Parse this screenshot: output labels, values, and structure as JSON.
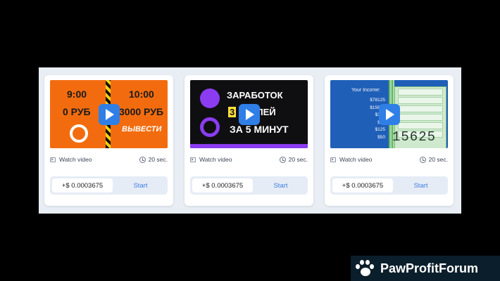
{
  "cards": [
    {
      "thumbnail": {
        "style": "orange",
        "top_left": "9:00",
        "top_right": "10:00",
        "bottom_left": "0 РУБ",
        "bottom_right": "3000 РУБ",
        "caption": "ВЫВЕСТИ"
      },
      "watch_label": "Watch video",
      "duration": "20 sec.",
      "reward": "+$ 0.0003675",
      "start_label": "Start"
    },
    {
      "thumbnail": {
        "style": "dark",
        "line1": "ЗАРАБОТОК",
        "line2_highlight": "3",
        "line2_rest": "РУБЛЕЙ",
        "line3": "ЗА 5 МИНУТ"
      },
      "watch_label": "Watch video",
      "duration": "20 sec.",
      "reward": "+$ 0.0003675",
      "start_label": "Start"
    },
    {
      "thumbnail": {
        "style": "blue",
        "income_label": "Your Income:",
        "values": [
          "$78125",
          "$15625",
          "$312",
          "$62",
          "$125",
          "$50"
        ],
        "big_number": "15625"
      },
      "watch_label": "Watch video",
      "duration": "20 sec.",
      "reward": "+$ 0.0003675",
      "start_label": "Start"
    }
  ],
  "brand": {
    "name": "PawProfitForum",
    "icon": "paw-icon"
  },
  "colors": {
    "accent": "#3f7ee0",
    "play": "#2f7fe6",
    "panel": "#e9eef5",
    "brand_bg": "#0b1e2b"
  }
}
